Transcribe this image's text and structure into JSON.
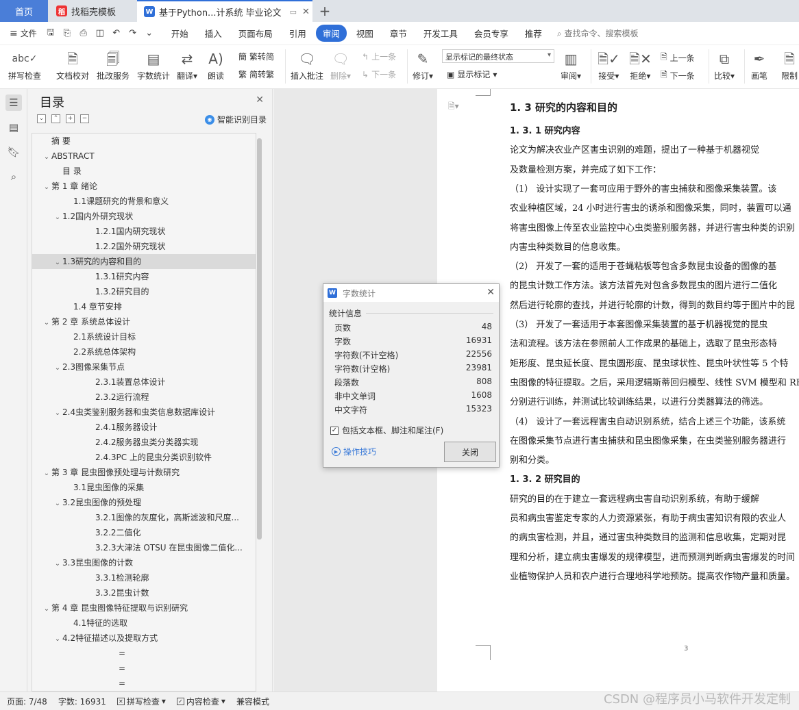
{
  "tabs": {
    "home": "首页",
    "template": "找稻壳模板",
    "document": "基于Python...计系统 毕业论文"
  },
  "menu": [
    "开始",
    "插入",
    "页面布局",
    "引用",
    "审阅",
    "视图",
    "章节",
    "开发工具",
    "会员专享",
    "推荐"
  ],
  "file_label": "文件",
  "search_cmd": "查找命令、搜索模板",
  "ribbon": {
    "spell_check": "拼写检查",
    "doc_proof": "文档校对",
    "annotate_service": "批改服务",
    "word_count": "字数统计",
    "translate": "翻译",
    "read_aloud": "朗读",
    "trad": "繁转简",
    "simp": "简转繁",
    "insert_comment": "插入批注",
    "delete": "删除",
    "prev_comment": "上一条",
    "next_comment": "下一条",
    "revise": "修订",
    "markup_state": "显示标记的最终状态",
    "show_markup": "显示标记",
    "review": "审阅",
    "accept": "接受",
    "reject": "拒绝",
    "prev": "上一条",
    "next": "下一条",
    "compare": "比较",
    "draw": "画笔",
    "restrict": "限制"
  },
  "toc": {
    "title": "目录",
    "smart": "智能识别目录",
    "items": [
      {
        "text": "摘 要",
        "indent": 1,
        "arrow": ""
      },
      {
        "text": "ABSTRACT",
        "indent": 1,
        "arrow": "v"
      },
      {
        "text": "目 录",
        "indent": 2,
        "arrow": ""
      },
      {
        "text": "第 1 章 绪论",
        "indent": 1,
        "arrow": "v"
      },
      {
        "text": "1.1课题研究的背景和意义",
        "indent": 3,
        "arrow": ""
      },
      {
        "text": "1.2国内外研究现状",
        "indent": 2,
        "arrow": "v"
      },
      {
        "text": "1.2.1国内研究现状",
        "indent": 4,
        "arrow": ""
      },
      {
        "text": "1.2.2国外研究现状",
        "indent": 4,
        "arrow": ""
      },
      {
        "text": "1.3研究的内容和目的",
        "indent": 2,
        "arrow": "v",
        "selected": true
      },
      {
        "text": "1.3.1研究内容",
        "indent": 4,
        "arrow": ""
      },
      {
        "text": "1.3.2研究目的",
        "indent": 4,
        "arrow": ""
      },
      {
        "text": "1.4 章节安排",
        "indent": 3,
        "arrow": ""
      },
      {
        "text": "第 2 章 系统总体设计",
        "indent": 1,
        "arrow": "v"
      },
      {
        "text": "2.1系统设计目标",
        "indent": 3,
        "arrow": ""
      },
      {
        "text": "2.2系统总体架构",
        "indent": 3,
        "arrow": ""
      },
      {
        "text": "2.3图像采集节点",
        "indent": 2,
        "arrow": "v"
      },
      {
        "text": "2.3.1装置总体设计",
        "indent": 4,
        "arrow": ""
      },
      {
        "text": "2.3.2运行流程",
        "indent": 4,
        "arrow": ""
      },
      {
        "text": "2.4虫类鉴别服务器和虫类信息数据库设计",
        "indent": 2,
        "arrow": "v"
      },
      {
        "text": "2.4.1服务器设计",
        "indent": 4,
        "arrow": ""
      },
      {
        "text": "2.4.2服务器虫类分类器实现",
        "indent": 4,
        "arrow": ""
      },
      {
        "text": "2.4.3PC 上的昆虫分类识别软件",
        "indent": 4,
        "arrow": ""
      },
      {
        "text": "第 3 章 昆虫图像预处理与计数研究",
        "indent": 1,
        "arrow": "v"
      },
      {
        "text": "3.1昆虫图像的采集",
        "indent": 3,
        "arrow": ""
      },
      {
        "text": "3.2昆虫图像的预处理",
        "indent": 2,
        "arrow": "v"
      },
      {
        "text": "3.2.1图像的灰度化，高斯滤波和尺度...",
        "indent": 4,
        "arrow": ""
      },
      {
        "text": "3.2.2二值化",
        "indent": 4,
        "arrow": ""
      },
      {
        "text": "3.2.3大津法 OTSU 在昆虫图像二值化...",
        "indent": 4,
        "arrow": ""
      },
      {
        "text": "3.3昆虫图像的计数",
        "indent": 2,
        "arrow": "v"
      },
      {
        "text": "3.3.1检测轮廓",
        "indent": 4,
        "arrow": ""
      },
      {
        "text": "3.3.2昆虫计数",
        "indent": 4,
        "arrow": ""
      },
      {
        "text": "第 4 章 昆虫图像特征提取与识别研究",
        "indent": 1,
        "arrow": "v"
      },
      {
        "text": "4.1特征的选取",
        "indent": 3,
        "arrow": ""
      },
      {
        "text": "4.2特征描述以及提取方式",
        "indent": 2,
        "arrow": "v"
      },
      {
        "text": "=",
        "indent": 5,
        "arrow": ""
      },
      {
        "text": "=",
        "indent": 5,
        "arrow": ""
      },
      {
        "text": "=",
        "indent": 5,
        "arrow": ""
      }
    ]
  },
  "document": {
    "lines": [
      {
        "text": "1. 3  研究的内容和目的",
        "style": "h1"
      },
      {
        "text": "1. 3. 1  研究内容",
        "style": "h2"
      },
      {
        "text": "      论文为解决农业产区害虫识别的难题，提出了一种基于机器视觉",
        "style": ""
      },
      {
        "text": "及数量检测方案，并完成了如下工作：",
        "style": ""
      },
      {
        "text": "（1） 设计实现了一套可应用于野外的害虫捕获和图像采集装置。该",
        "style": ""
      },
      {
        "text": "农业种植区域，24 小时进行害虫的诱杀和图像采集，同时，装置可以通",
        "style": ""
      },
      {
        "text": "将害虫图像上传至农业监控中心虫类鉴别服务器，并进行害虫种类的识别",
        "style": ""
      },
      {
        "text": "内害虫种类数目的信息收集。",
        "style": ""
      },
      {
        "text": "（2） 开发了一套的适用于苍蝇粘板等包含多数昆虫设备的图像的基",
        "style": ""
      },
      {
        "text": "的昆虫计数工作方法。该方法首先对包含多数昆虫的图片进行二值化",
        "style": ""
      },
      {
        "text": "然后进行轮廓的查找，并进行轮廓的计数，得到的数目约等于图片中的昆",
        "style": ""
      },
      {
        "text": "（3） 开发了一套适用于本套图像采集装置的基于机器视觉的昆虫",
        "style": ""
      },
      {
        "text": "法和流程。该方法在参照前人工作成果的基础上，选取了昆虫形态特",
        "style": ""
      },
      {
        "text": "矩形度、昆虫延长度、昆虫圆形度、昆虫球状性、昆虫叶状性等 5 个特",
        "style": ""
      },
      {
        "text": "虫图像的特征提取。之后，采用逻辑斯蒂回归模型、线性 SVM 模型和 RB",
        "style": ""
      },
      {
        "text": "分别进行训练，并测试比较训练结果，以进行分类器算法的筛选。",
        "style": ""
      },
      {
        "text": "（4） 设计了一套远程害虫自动识别系统，结合上述三个功能，该系统",
        "style": ""
      },
      {
        "text": "在图像采集节点进行害虫捕获和昆虫图像采集，在虫类鉴别服务器进行",
        "style": ""
      },
      {
        "text": "别和分类。",
        "style": ""
      },
      {
        "text": "1. 3. 2  研究目的",
        "style": "h2"
      },
      {
        "text": "      研究的目的在于建立一套远程病虫害自动识别系统，有助于缓解",
        "style": ""
      },
      {
        "text": "员和病虫害鉴定专家的人力资源紧张，有助于病虫害知识有限的农业人",
        "style": ""
      },
      {
        "text": "的病虫害检测，并且，通过害虫种类数目的监测和信息收集，定期对昆",
        "style": ""
      },
      {
        "text": "理和分析，建立病虫害爆发的规律模型，进而预测判断病虫害爆发的时间",
        "style": ""
      },
      {
        "text": "业植物保护人员和农户进行合理地科学地预防。提高农作物产量和质量。",
        "style": ""
      }
    ],
    "page_number": "3"
  },
  "dialog": {
    "title": "字数统计",
    "section": "统计信息",
    "rows": [
      {
        "label": "页数",
        "value": "48"
      },
      {
        "label": "字数",
        "value": "16931"
      },
      {
        "label": "字符数(不计空格)",
        "value": "22556"
      },
      {
        "label": "字符数(计空格)",
        "value": "23981"
      },
      {
        "label": "段落数",
        "value": "808"
      },
      {
        "label": "非中文单词",
        "value": "1608"
      },
      {
        "label": "中文字符",
        "value": "15323"
      }
    ],
    "include_label": "包括文本框、脚注和尾注(F)",
    "tips": "操作技巧",
    "close": "关闭"
  },
  "status": {
    "page": "页面: 7/48",
    "words": "字数: 16931",
    "spell": "拼写检查",
    "content_check": "内容检查",
    "mode": "兼容模式"
  },
  "watermark": "CSDN @程序员小马软件开发定制"
}
